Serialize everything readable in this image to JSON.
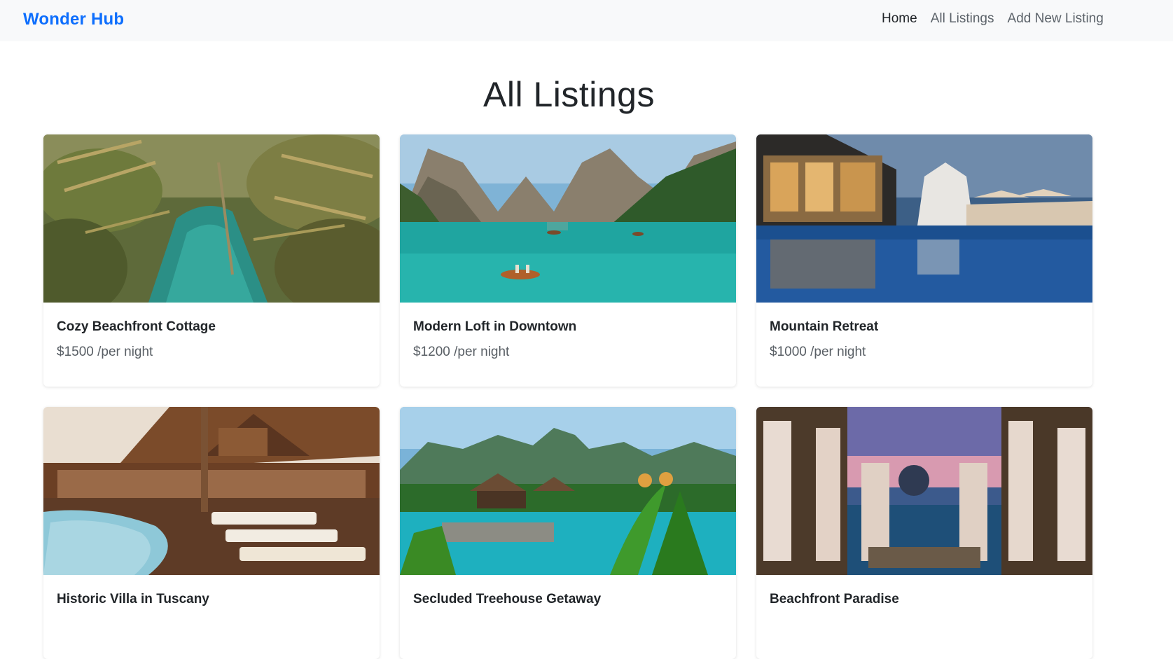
{
  "navbar": {
    "brand": "Wonder Hub",
    "links": [
      {
        "label": "Home"
      },
      {
        "label": "All Listings"
      },
      {
        "label": "Add New Listing"
      }
    ]
  },
  "page": {
    "title": "All Listings"
  },
  "listings": [
    {
      "title": "Cozy Beachfront Cottage",
      "price": "$1500 /per night",
      "image": "tropical-river-photo"
    },
    {
      "title": "Modern Loft in Downtown",
      "price": "$1200 /per night",
      "image": "mountain-lake-photo"
    },
    {
      "title": "Mountain Retreat",
      "price": "$1000 /per night",
      "image": "resort-pool-night-photo"
    },
    {
      "title": "Historic Villa in Tuscany",
      "price": "",
      "image": "wooden-villa-pool-photo"
    },
    {
      "title": "Secluded Treehouse Getaway",
      "price": "",
      "image": "jungle-resort-pool-photo"
    },
    {
      "title": "Beachfront Paradise",
      "price": "",
      "image": "cabana-sunset-photo"
    }
  ]
}
